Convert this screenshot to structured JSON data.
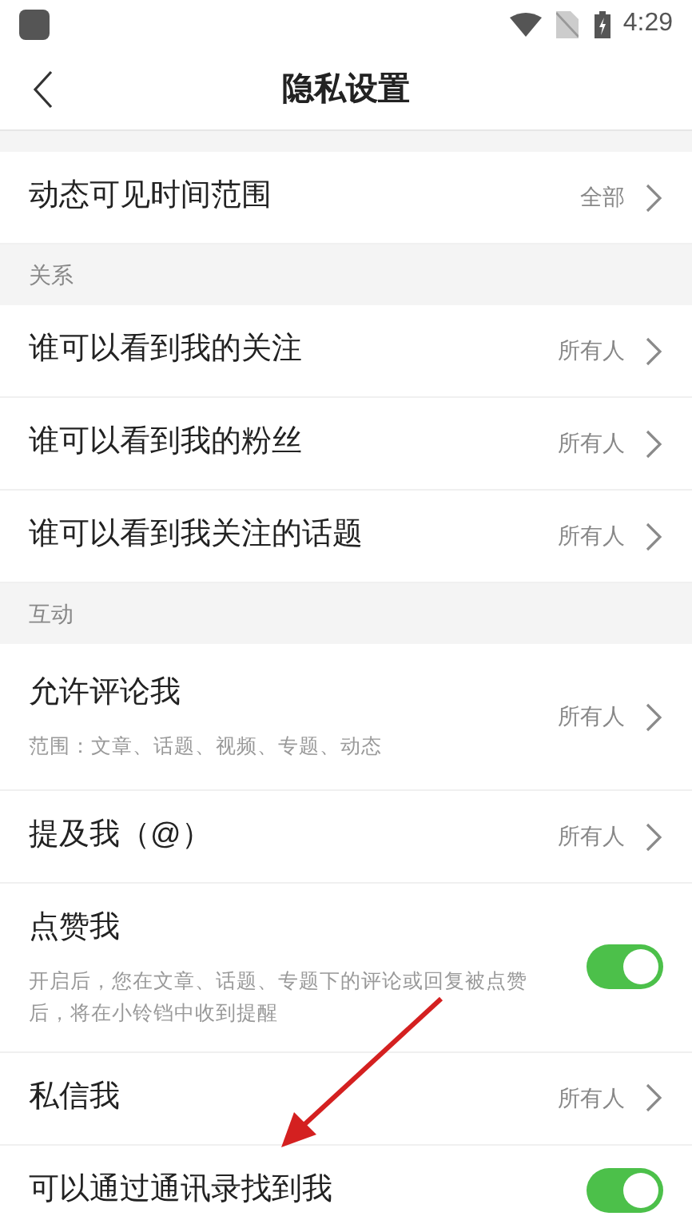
{
  "status_bar": {
    "time": "4:29"
  },
  "header": {
    "title": "隐私设置"
  },
  "sections": [
    {
      "items": [
        {
          "kind": "nav",
          "title": "动态可见时间范围",
          "value": "全部"
        }
      ]
    },
    {
      "header": "关系",
      "items": [
        {
          "kind": "nav",
          "title": "谁可以看到我的关注",
          "value": "所有人"
        },
        {
          "kind": "nav",
          "title": "谁可以看到我的粉丝",
          "value": "所有人"
        },
        {
          "kind": "nav",
          "title": "谁可以看到我关注的话题",
          "value": "所有人"
        }
      ]
    },
    {
      "header": "互动",
      "items": [
        {
          "kind": "nav",
          "title": "允许评论我",
          "subtitle": "范围：文章、话题、视频、专题、动态",
          "value": "所有人"
        },
        {
          "kind": "nav",
          "title": "提及我（@）",
          "value": "所有人"
        },
        {
          "kind": "toggle",
          "title": "点赞我",
          "subtitle": "开启后，您在文章、话题、专题下的评论或回复被点赞后，将在小铃铛中收到提醒",
          "on": true
        },
        {
          "kind": "nav",
          "title": "私信我",
          "value": "所有人"
        },
        {
          "kind": "toggle",
          "title": "可以通过通讯录找到我",
          "on": true
        }
      ]
    }
  ]
}
